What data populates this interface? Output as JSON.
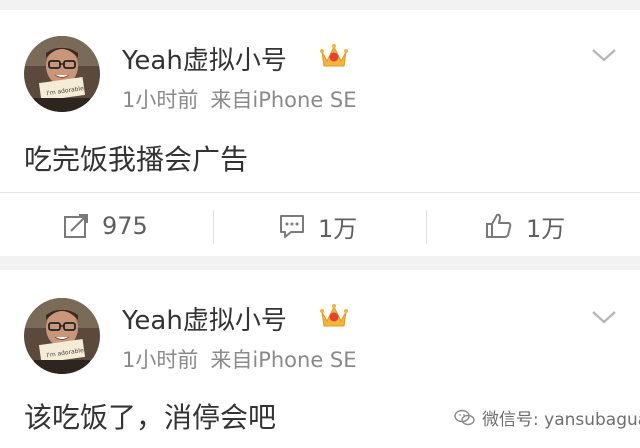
{
  "posts": [
    {
      "username": "Yeah虚拟小号",
      "time": "1小时前",
      "source": "来自iPhone SE",
      "content": "吃完饭我播会广告",
      "actions": {
        "repost_count": "975",
        "comment_count": "1万",
        "like_count": "1万"
      }
    },
    {
      "username": "Yeah虚拟小号",
      "time": "1小时前",
      "source": "来自iPhone SE",
      "content": "该吃饭了，消停会吧"
    }
  ],
  "watermark": {
    "text": "微信号: yansubagua"
  },
  "colors": {
    "background": "#f2f2f2",
    "card": "#ffffff",
    "text": "#333333",
    "meta": "#8a8a8a",
    "vip_badge": "#f3b53f"
  },
  "icons": [
    "avatar",
    "vip-crown-icon",
    "chevron-down-icon",
    "repost-icon",
    "comment-icon",
    "like-icon",
    "wechat-icon"
  ]
}
